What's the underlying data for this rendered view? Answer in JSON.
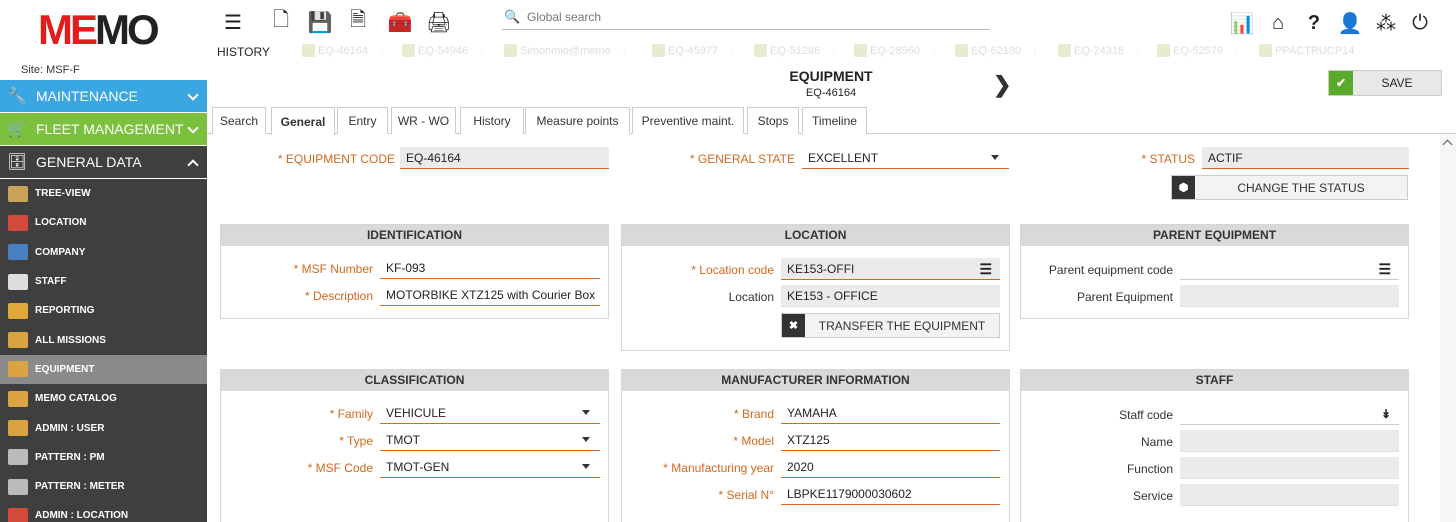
{
  "brand": {
    "logo_left": "ME",
    "logo_o": "MO",
    "site": "Site: MSF-F"
  },
  "sidebar": {
    "maintenance": "MAINTENANCE",
    "fleet": "FLEET MANAGEMENT",
    "general": "GENERAL DATA",
    "items": [
      {
        "label": "TREE-VIEW",
        "icon": "tree-icon",
        "color": "#c9a35a"
      },
      {
        "label": "LOCATION",
        "icon": "location-icon",
        "color": "#d24a3a"
      },
      {
        "label": "COMPANY",
        "icon": "company-icon",
        "color": "#4a7fc1"
      },
      {
        "label": "STAFF",
        "icon": "staff-icon",
        "color": "#dddddd"
      },
      {
        "label": "REPORTING",
        "icon": "reporting-icon",
        "color": "#e0a83a"
      },
      {
        "label": "ALL MISSIONS",
        "icon": "missions-icon",
        "color": "#d9a441"
      },
      {
        "label": "EQUIPMENT",
        "icon": "equipment-icon",
        "color": "#d9a441"
      },
      {
        "label": "MEMO CATALOG",
        "icon": "catalog-icon",
        "color": "#d9a441"
      },
      {
        "label": "ADMIN : USER",
        "icon": "admin-user-icon",
        "color": "#d9a441"
      },
      {
        "label": "PATTERN : PM",
        "icon": "pattern-pm-icon",
        "color": "#bbbbbb"
      },
      {
        "label": "PATTERN : METER",
        "icon": "pattern-meter-icon",
        "color": "#bbbbbb"
      },
      {
        "label": "ADMIN : LOCATION",
        "icon": "admin-location-icon",
        "color": "#d24a3a"
      }
    ]
  },
  "search": {
    "placeholder": "Global search"
  },
  "history": {
    "label": "HISTORY",
    "items": [
      "EQ-46164",
      "EQ-54946",
      "Simonmio@memo",
      "EQ-45977",
      "EQ-51286",
      "EQ-28960",
      "EQ-62180",
      "EQ-24318",
      "EQ-52579",
      "PPACTRUCP14"
    ]
  },
  "page": {
    "title": "EQUIPMENT",
    "subtitle": "EQ-46164",
    "save": "SAVE"
  },
  "tabs": [
    "Search",
    "General",
    "Entry",
    "WR - WO",
    "History",
    "Measure points",
    "Preventive maint.",
    "Stops",
    "Timeline"
  ],
  "header_fields": {
    "equipment_code_label": "* EQUIPMENT CODE",
    "equipment_code": "EQ-46164",
    "general_state_label": "* GENERAL STATE",
    "general_state": "EXCELLENT",
    "status_label": "* STATUS",
    "status": "ACTIF",
    "change_status": "CHANGE THE STATUS"
  },
  "identification": {
    "title": "IDENTIFICATION",
    "msf_label": "* MSF Number",
    "msf": "KF-093",
    "desc_label": "* Description",
    "desc": "MOTORBIKE XTZ125 with Courier Box"
  },
  "location": {
    "title": "LOCATION",
    "code_label": "* Location code",
    "code": "KE153-OFFI",
    "loc_label": "Location",
    "loc": "KE153 - OFFICE",
    "transfer": "TRANSFER THE EQUIPMENT"
  },
  "parent": {
    "title": "PARENT EQUIPMENT",
    "code_label": "Parent equipment code",
    "code": "",
    "eq_label": "Parent Equipment",
    "eq": ""
  },
  "classification": {
    "title": "CLASSIFICATION",
    "family_label": "* Family",
    "family": "VEHICULE",
    "type_label": "* Type",
    "type": "TMOT",
    "msfcode_label": "* MSF Code",
    "msfcode": "TMOT-GEN"
  },
  "manufacturer": {
    "title": "MANUFACTURER INFORMATION",
    "brand_label": "* Brand",
    "brand": "YAMAHA",
    "model_label": "* Model",
    "model": "XTZ125",
    "year_label": "* Manufacturing year",
    "year": "2020",
    "serial_label": "* Serial N°",
    "serial": "LBPKE1179000030602"
  },
  "staff": {
    "title": "STAFF",
    "code_label": "Staff code",
    "code": "",
    "name_label": "Name",
    "name": "",
    "function_label": "Function",
    "function": "",
    "service_label": "Service",
    "service": ""
  }
}
